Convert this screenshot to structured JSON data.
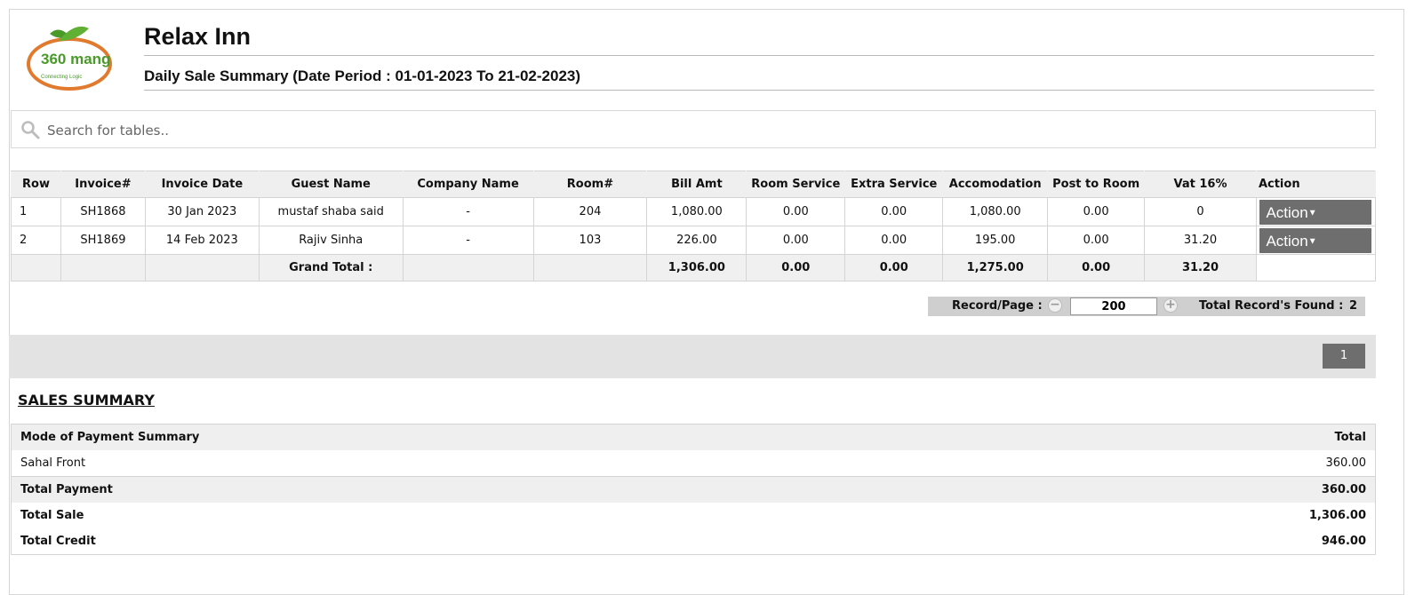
{
  "header": {
    "hotel_name": "Relax Inn",
    "report_title": "Daily Sale Summary (Date Period : 01-01-2023 To 21-02-2023)",
    "logo_text": "360 mang",
    "logo_tagline": "Connecting Logic"
  },
  "search": {
    "placeholder": "Search for tables.."
  },
  "table": {
    "headers": [
      "Row",
      "Invoice#",
      "Invoice Date",
      "Guest Name",
      "Company Name",
      "Room#",
      "Bill Amt",
      "Room Service",
      "Extra Service",
      "Accomodation",
      "Post to Room",
      "Vat 16%",
      "Action"
    ],
    "rows": [
      {
        "row": "1",
        "invoice": "SH1868",
        "date": "30 Jan 2023",
        "guest": "mustaf shaba said",
        "company": "-",
        "room": "204",
        "bill": "1,080.00",
        "room_service": "0.00",
        "extra_service": "0.00",
        "accomodation": "1,080.00",
        "post_to_room": "0.00",
        "vat": "0",
        "action": "Action"
      },
      {
        "row": "2",
        "invoice": "SH1869",
        "date": "14 Feb 2023",
        "guest": "Rajiv Sinha",
        "company": "-",
        "room": "103",
        "bill": "226.00",
        "room_service": "0.00",
        "extra_service": "0.00",
        "accomodation": "195.00",
        "post_to_room": "0.00",
        "vat": "31.20",
        "action": "Action"
      }
    ],
    "totals": {
      "label": "Grand Total :",
      "bill": "1,306.00",
      "room_service": "0.00",
      "extra_service": "0.00",
      "accomodation": "1,275.00",
      "post_to_room": "0.00",
      "vat": "31.20"
    }
  },
  "pager": {
    "record_label": "Record/Page :",
    "records_per_page": "200",
    "found_label": "Total Record's Found :",
    "found_count": "2",
    "current_page": "1"
  },
  "summary": {
    "heading": "SALES SUMMARY",
    "header_left": "Mode of Payment Summary",
    "header_right": "Total",
    "payment_name": "Sahal Front",
    "payment_value": "360.00",
    "total_payment_label": "Total Payment",
    "total_payment": "360.00",
    "total_sale_label": "Total Sale",
    "total_sale": "1,306.00",
    "total_credit_label": "Total Credit",
    "total_credit": "946.00"
  },
  "colors": {
    "button": "#6e6e6e",
    "header_bg": "#efefef",
    "logo_orange": "#e07a2e",
    "logo_green": "#4a9a2a"
  }
}
